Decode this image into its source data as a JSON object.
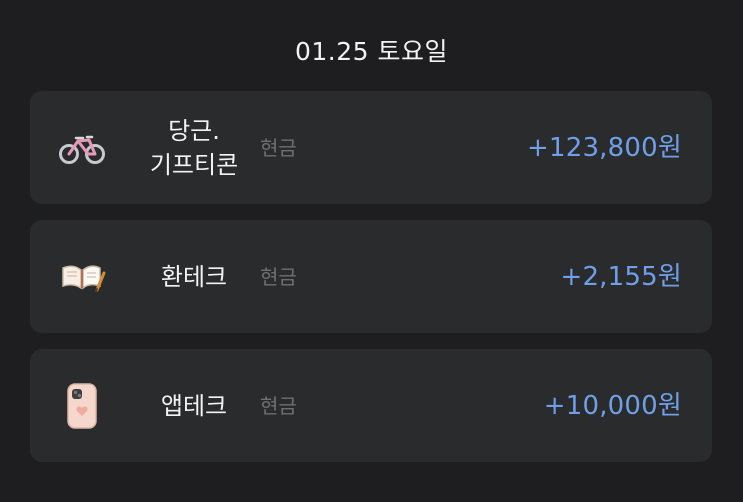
{
  "header": {
    "date": "01.25 토요일"
  },
  "transactions": [
    {
      "icon": "bicycle-icon",
      "title": "당근.\n기프티콘",
      "method": "현금",
      "amount": "+123,800원"
    },
    {
      "icon": "book-pencil-icon",
      "title": "환테크",
      "method": "현금",
      "amount": "+2,155원"
    },
    {
      "icon": "smartphone-icon",
      "title": "앱테크",
      "method": "현금",
      "amount": "+10,000원"
    }
  ],
  "colors": {
    "background": "#1e1e20",
    "card": "#2a2b2d",
    "income": "#6f9fe8",
    "muted": "#6e6f73",
    "text": "#f3f3f3"
  }
}
